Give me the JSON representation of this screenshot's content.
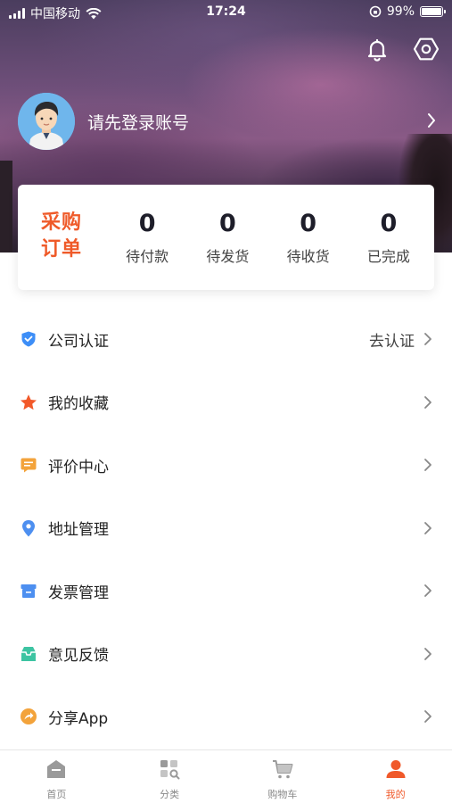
{
  "status_bar": {
    "carrier": "中国移动",
    "time": "17:24",
    "battery": "99%"
  },
  "profile": {
    "login_prompt": "请先登录账号"
  },
  "order_card": {
    "logo_line1": "采购",
    "logo_line2": "订单",
    "stats": [
      {
        "count": "0",
        "label": "待付款"
      },
      {
        "count": "0",
        "label": "待发货"
      },
      {
        "count": "0",
        "label": "待收货"
      },
      {
        "count": "0",
        "label": "已完成"
      }
    ]
  },
  "menu": [
    {
      "label": "公司认证",
      "extra": "去认证",
      "icon": "shield-check-icon",
      "color": "#3d8ef7"
    },
    {
      "label": "我的收藏",
      "extra": "",
      "icon": "star-icon",
      "color": "#f2592a"
    },
    {
      "label": "评价中心",
      "extra": "",
      "icon": "comment-icon",
      "color": "#f3a33b"
    },
    {
      "label": "地址管理",
      "extra": "",
      "icon": "location-pin-icon",
      "color": "#4d8ff0"
    },
    {
      "label": "发票管理",
      "extra": "",
      "icon": "invoice-icon",
      "color": "#4d8ff0"
    },
    {
      "label": "意见反馈",
      "extra": "",
      "icon": "feedback-icon",
      "color": "#3dc4a2"
    },
    {
      "label": "分享App",
      "extra": "",
      "icon": "share-icon",
      "color": "#f3a33b"
    }
  ],
  "tabbar": [
    {
      "label": "首页",
      "icon": "home-icon"
    },
    {
      "label": "分类",
      "icon": "category-icon"
    },
    {
      "label": "购物车",
      "icon": "cart-icon"
    },
    {
      "label": "我的",
      "icon": "user-icon",
      "active": true
    }
  ],
  "colors": {
    "accent": "#f0592a",
    "text": "#222222",
    "muted": "#888888"
  }
}
